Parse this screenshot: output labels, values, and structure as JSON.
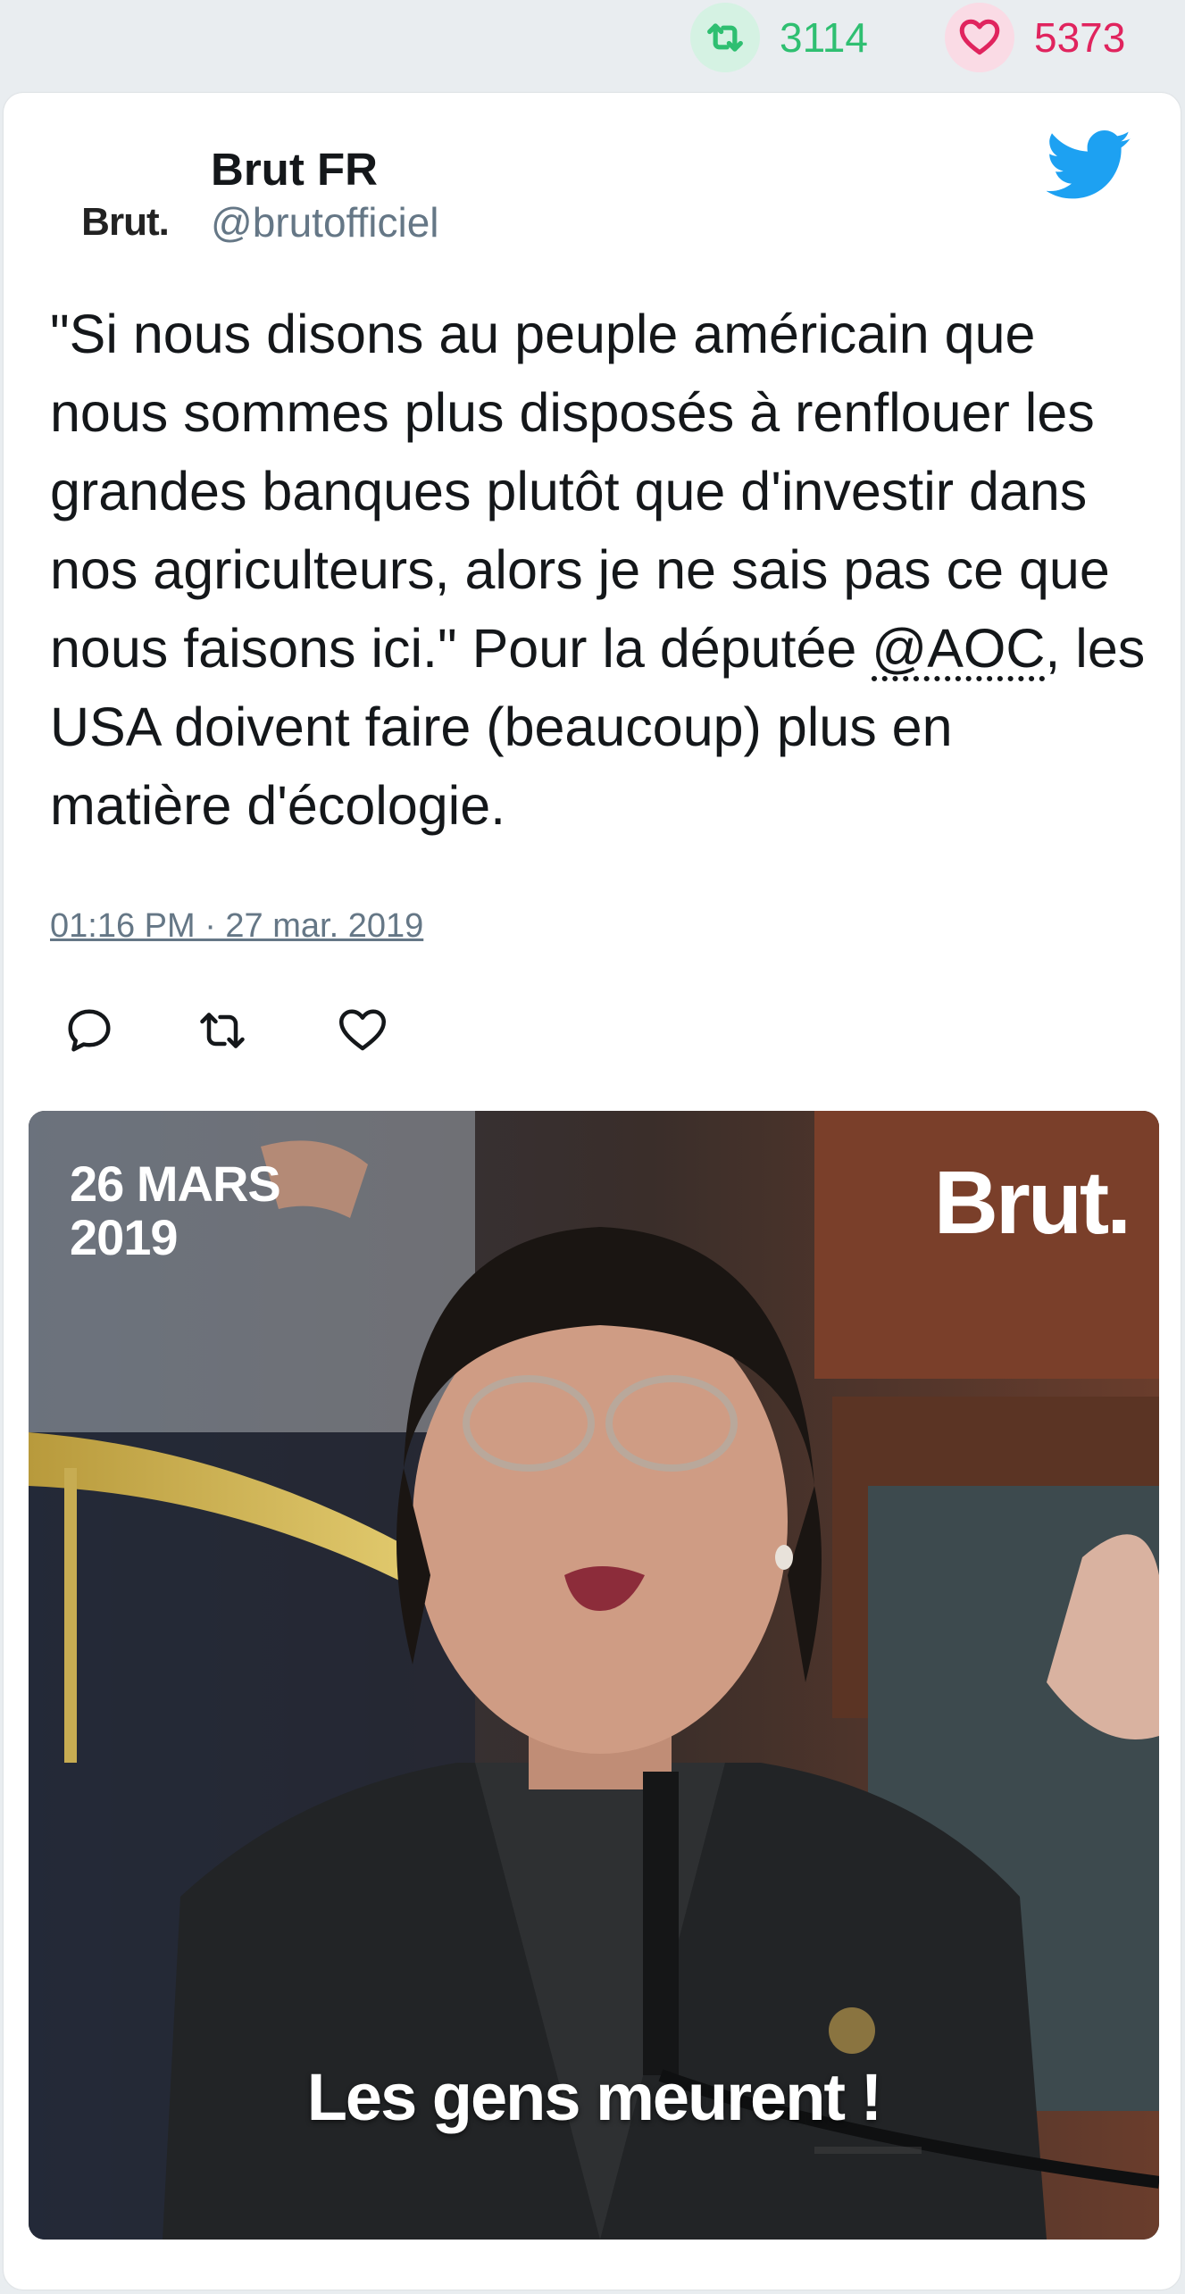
{
  "stats": {
    "retweets": "3114",
    "likes": "5373",
    "retweet_icon": "retweet-icon",
    "like_icon": "heart-icon",
    "retweet_color": "#2fbf71",
    "like_color": "#e0245e"
  },
  "tweet": {
    "author_name": "Brut FR",
    "author_handle": "@brutofficiel",
    "avatar_text": "Brut.",
    "text_before_mention": "\"Si nous disons au peuple américain que nous sommes plus disposés à renflouer les grandes banques plutôt que d'investir dans nos agriculteurs, alors je ne sais pas ce que nous faisons ici.\" Pour la députée ",
    "mention": "@AOC",
    "text_after_mention": ", les USA doivent faire (beaucoup) plus en matière d'écologie.",
    "timestamp": "01:16 PM · 27 mar. 2019",
    "brand_icon": "twitter-bird-icon",
    "brand_color": "#1da1f2"
  },
  "actions": [
    "reply-icon",
    "retweet-icon",
    "like-icon"
  ],
  "media": {
    "date_line1": "26 MARS",
    "date_line2": "2019",
    "brand": "Brut.",
    "caption": "Les gens meurent !"
  }
}
